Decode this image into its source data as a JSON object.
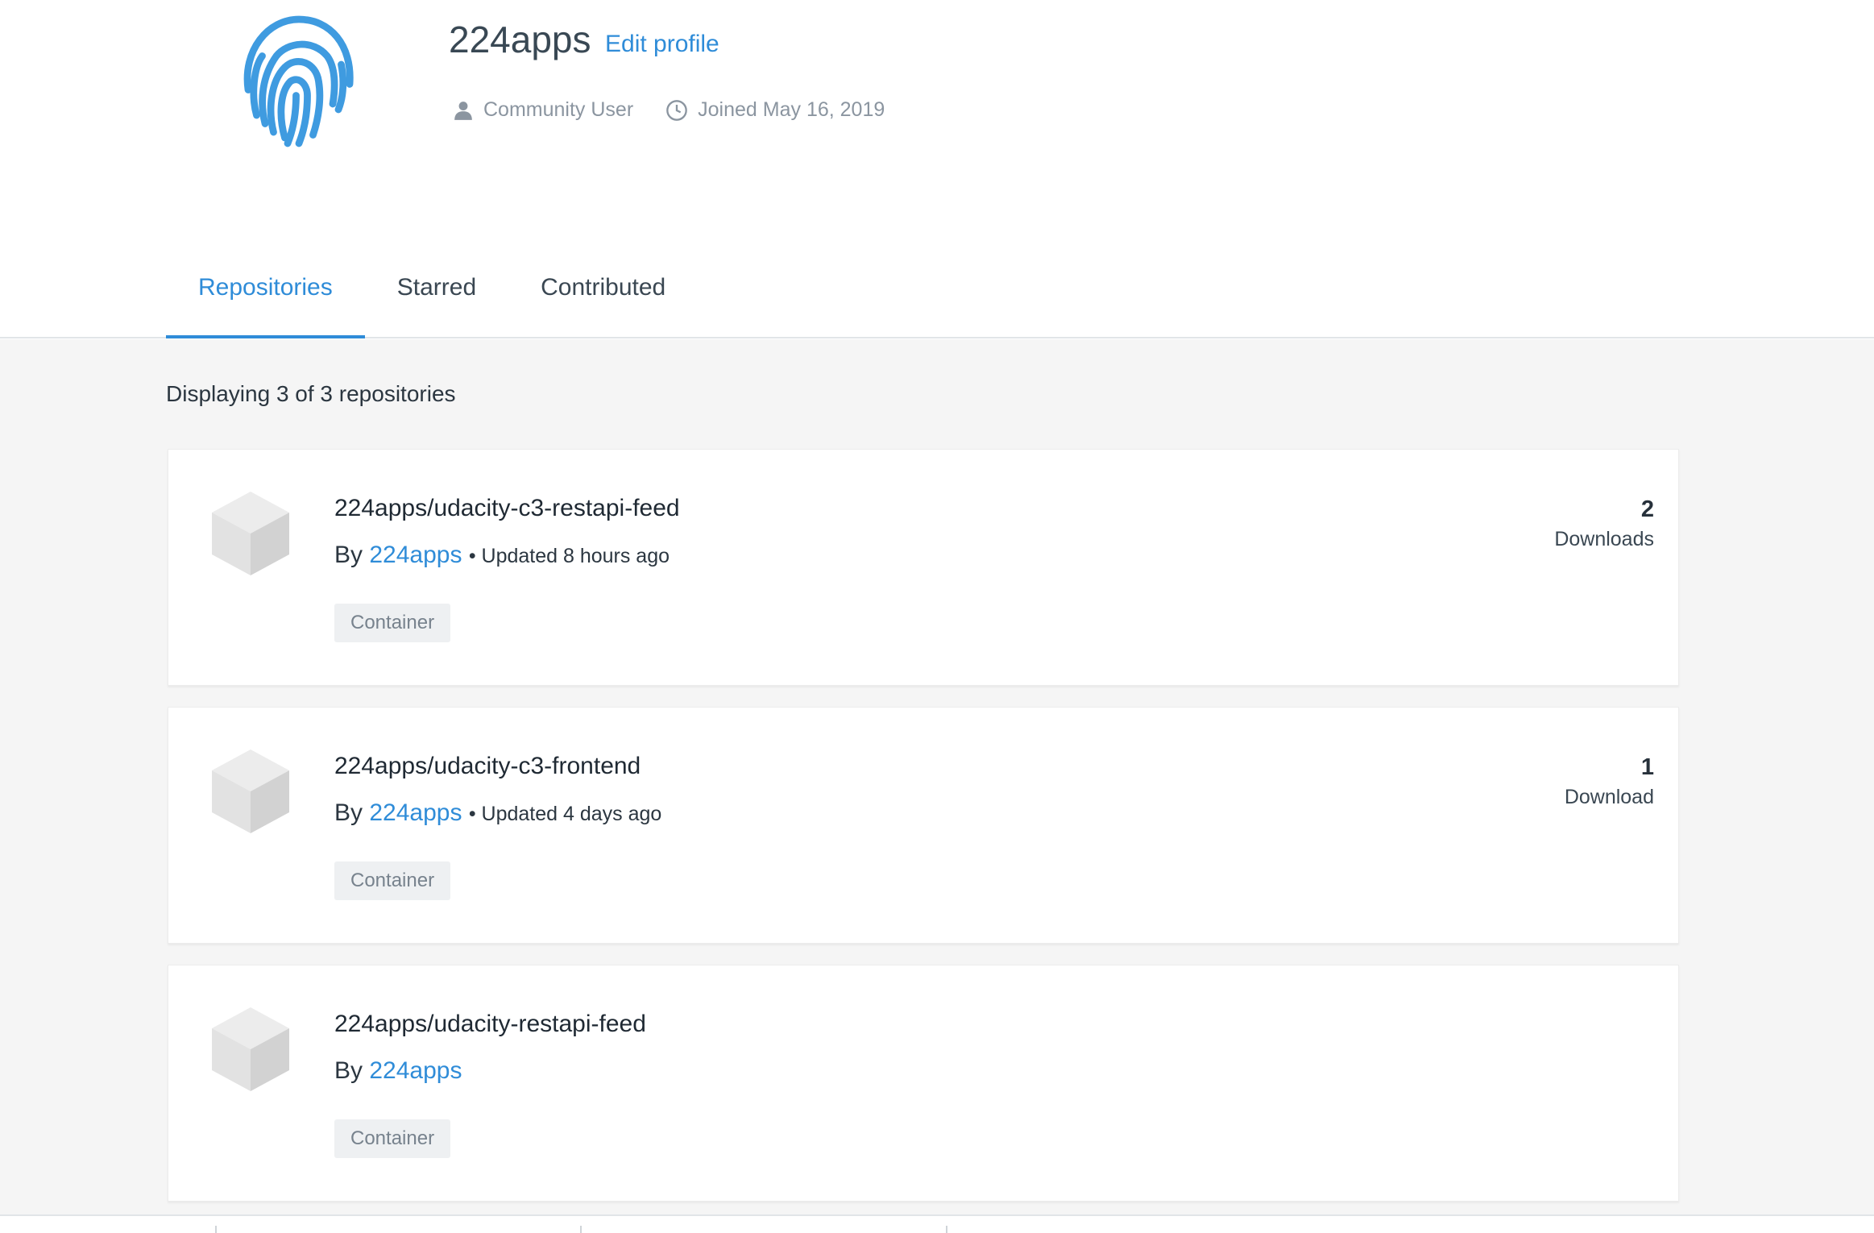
{
  "profile": {
    "name": "224apps",
    "edit_label": "Edit profile",
    "role": "Community User",
    "joined": "Joined May 16, 2019"
  },
  "tabs": [
    {
      "label": "Repositories",
      "active": true
    },
    {
      "label": "Starred",
      "active": false
    },
    {
      "label": "Contributed",
      "active": false
    }
  ],
  "summary": "Displaying 3 of 3 repositories",
  "repos": [
    {
      "name": "224apps/udacity-c3-restapi-feed",
      "by": "By",
      "owner": "224apps",
      "updated": "• Updated 8 hours ago",
      "badge": "Container",
      "downloads": "2",
      "downloads_label": "Downloads"
    },
    {
      "name": "224apps/udacity-c3-frontend",
      "by": "By",
      "owner": "224apps",
      "updated": "• Updated 4 days ago",
      "badge": "Container",
      "downloads": "1",
      "downloads_label": "Download"
    },
    {
      "name": "224apps/udacity-restapi-feed",
      "by": "By",
      "owner": "224apps",
      "badge": "Container"
    }
  ],
  "colors": {
    "accent": "#2f8cd8",
    "page_bg": "#f5f5f5"
  },
  "icons": {
    "avatar": "fingerprint-icon",
    "role": "user-icon",
    "joined": "clock-icon",
    "repo": "cube-icon"
  }
}
